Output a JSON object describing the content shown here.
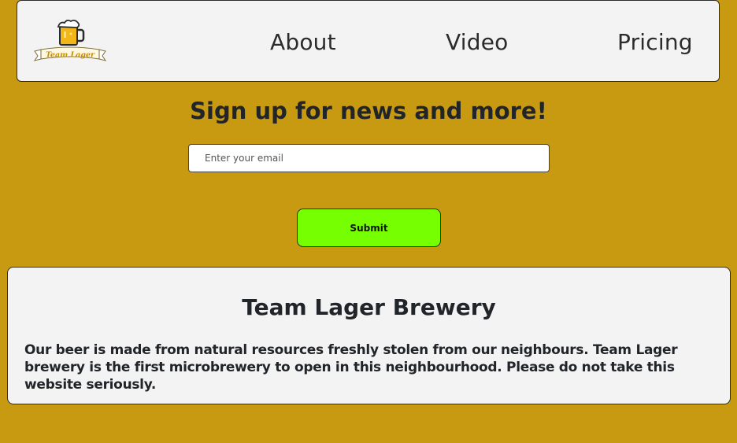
{
  "header": {
    "logo_text": "Team Lager",
    "nav": [
      {
        "label": "About"
      },
      {
        "label": "Video"
      },
      {
        "label": "Pricing"
      }
    ]
  },
  "signup": {
    "title": "Sign up for news and more!",
    "email_placeholder": "Enter your email",
    "email_value": "",
    "submit_label": "Submit"
  },
  "info": {
    "title": "Team Lager Brewery",
    "text": "Our beer is made from natural resources freshly stolen from our neighbours. Team Lager brewery is the first microbrewery to open in this neighbourhood. Please do not take this website seriously."
  },
  "colors": {
    "background": "#c79a12",
    "panel": "#f3f3f3",
    "submit_button": "#76ff00"
  },
  "icons": {
    "logo": "beer-mug-icon"
  }
}
